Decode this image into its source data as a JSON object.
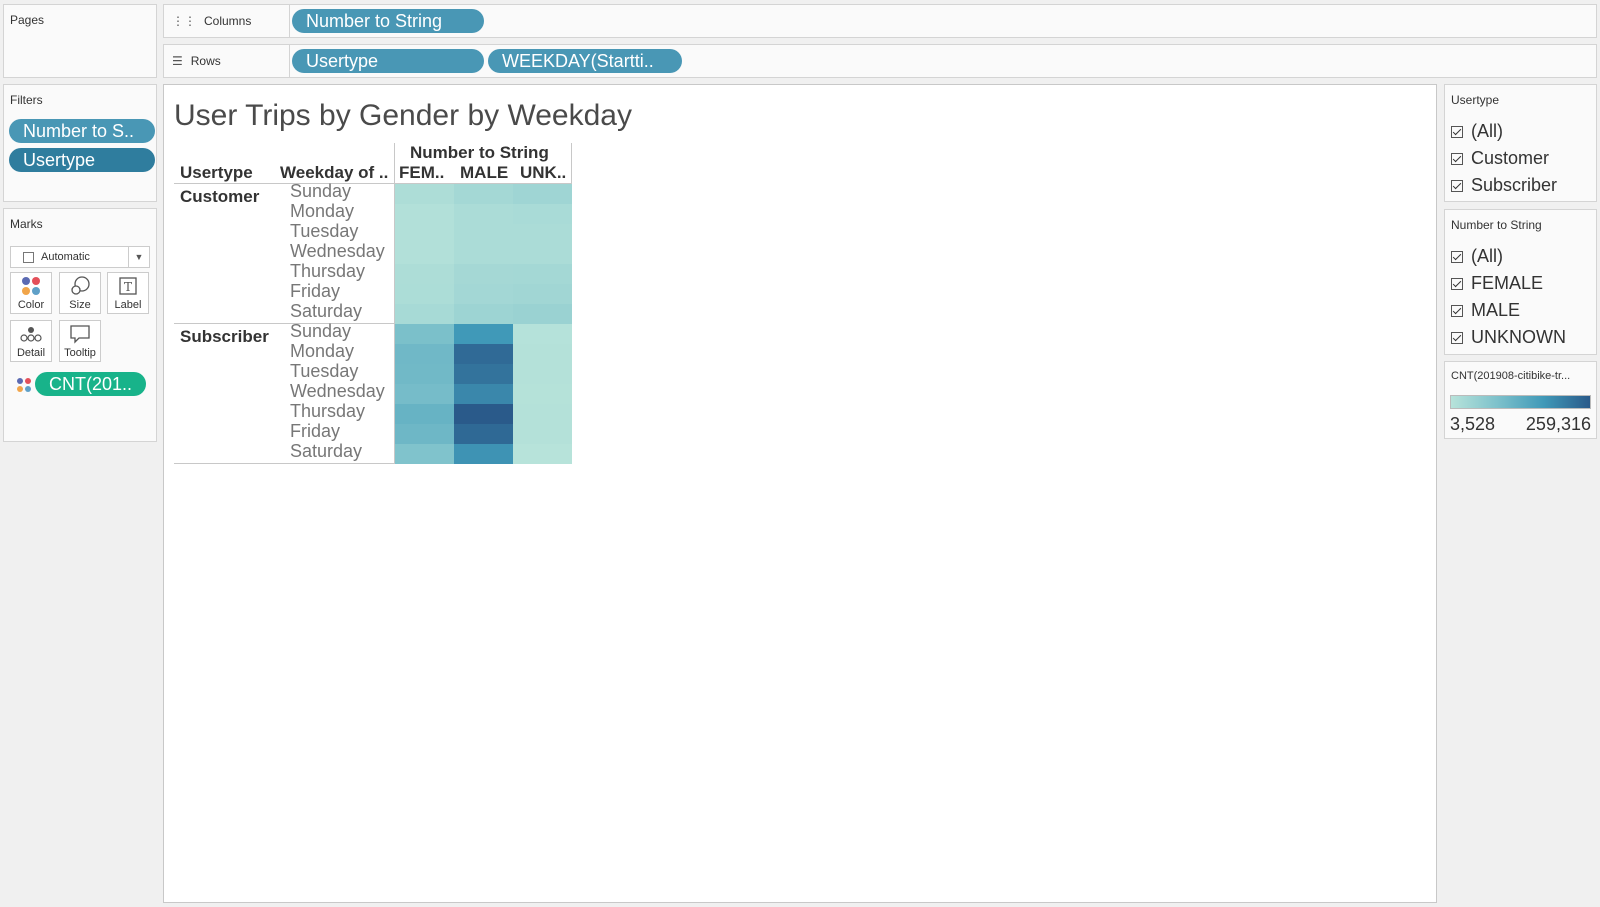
{
  "pages": {
    "label": "Pages"
  },
  "columns_shelf": {
    "label": "Columns",
    "pills": [
      "Number to String"
    ]
  },
  "rows_shelf": {
    "label": "Rows",
    "pills": [
      "Usertype",
      "WEEKDAY(Startti.."
    ]
  },
  "filters": {
    "label": "Filters",
    "pills": [
      "Number to S..",
      "Usertype"
    ]
  },
  "marks": {
    "label": "Marks",
    "type": "Automatic",
    "buttons": [
      "Color",
      "Size",
      "Label",
      "Detail",
      "Tooltip"
    ],
    "pill": "CNT(201.."
  },
  "viz": {
    "title": "User Trips by Gender by Weekday",
    "header_usertype": "Usertype",
    "header_weekday": "Weekday of ..",
    "header_group": "Number to String",
    "columns": [
      "FEM..",
      "MALE",
      "UNK.."
    ],
    "groups": [
      "Customer",
      "Subscriber"
    ],
    "days": [
      "Sunday",
      "Monday",
      "Tuesday",
      "Wednesday",
      "Thursday",
      "Friday",
      "Saturday"
    ]
  },
  "chart_data": {
    "type": "heatmap",
    "title": "User Trips by Gender by Weekday",
    "x_title": "Number to String",
    "x": [
      "FEM..",
      "MALE",
      "UNK.."
    ],
    "y_groups": [
      "Customer",
      "Subscriber"
    ],
    "y": [
      "Sunday",
      "Monday",
      "Tuesday",
      "Wednesday",
      "Thursday",
      "Friday",
      "Saturday"
    ],
    "color_range": [
      3528,
      259316
    ],
    "colors": {
      "low": "#b7e3da",
      "high": "#2a5a8a"
    },
    "values": {
      "Customer": [
        [
          9000,
          17000,
          22000
        ],
        [
          6000,
          11000,
          12000
        ],
        [
          6000,
          11000,
          11000
        ],
        [
          5500,
          10500,
          10500
        ],
        [
          9000,
          16000,
          17000
        ],
        [
          10000,
          18000,
          20000
        ],
        [
          14000,
          24000,
          27000
        ]
      ],
      "Subscriber": [
        [
          65000,
          152000,
          4000
        ],
        [
          80000,
          230000,
          4500
        ],
        [
          78000,
          215000,
          4600
        ],
        [
          72000,
          182000,
          4400
        ],
        [
          92000,
          259316,
          4800
        ],
        [
          83000,
          232000,
          4500
        ],
        [
          58000,
          162000,
          3528
        ]
      ]
    }
  },
  "legend_usertype": {
    "title": "Usertype",
    "items": [
      "(All)",
      "Customer",
      "Subscriber"
    ]
  },
  "legend_gender": {
    "title": "Number to String",
    "items": [
      "(All)",
      "FEMALE",
      "MALE",
      "UNKNOWN"
    ]
  },
  "legend_color": {
    "title": "CNT(201908-citibike-tr...",
    "min_label": "3,528",
    "max_label": "259,316"
  }
}
